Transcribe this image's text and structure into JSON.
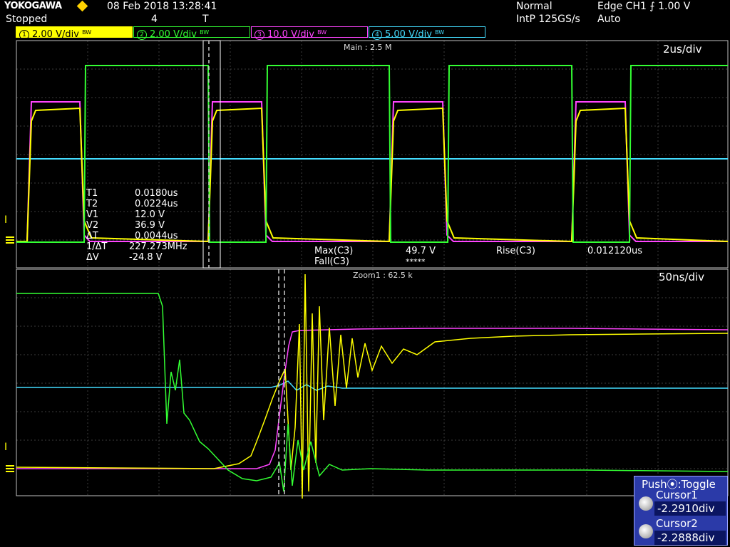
{
  "header": {
    "brand": "YOKOGAWA",
    "date_time": "08 Feb 2018 13:28:41",
    "status": "Stopped",
    "acq_count": "4",
    "mode": "Normal",
    "sampling": "IntP 125GS/s",
    "trigger": "Edge CH1 ⨍ 1.00 V",
    "trigger_mode": "Auto"
  },
  "channels": [
    {
      "num": "1",
      "scale": "2.00 V/div",
      "bw": "BW",
      "color": "#ffff00"
    },
    {
      "num": "2",
      "scale": "2.00 V/div",
      "bw": "BW",
      "color": "#33ff33"
    },
    {
      "num": "3",
      "scale": "10.0 V/div",
      "bw": "BW",
      "color": "#ff44ff"
    },
    {
      "num": "4",
      "scale": "5.00 V/div",
      "bw": "BW",
      "color": "#44ddff"
    }
  ],
  "main_panel": {
    "label": "Main : 2.5 M",
    "timebase": "2us/div"
  },
  "zoom_panel": {
    "label": "Zoom1 : 62.5 k",
    "timebase": "50ns/div"
  },
  "cursor_readout": [
    {
      "key": "T1",
      "value": "0.0180us"
    },
    {
      "key": "T2",
      "value": "0.0224us"
    },
    {
      "key": "V1",
      "value": "12.0 V"
    },
    {
      "key": "V2",
      "value": "36.9 V"
    },
    {
      "key": "ΔT",
      "value": "0.0044us"
    },
    {
      "key": "1/ΔT",
      "value": "227.273MHz"
    },
    {
      "key": "ΔV",
      "value": "-24.8 V"
    }
  ],
  "measurements": {
    "max_label": "Max(C3)",
    "max_value": "49.7 V",
    "fall_label": "Fall(C3)",
    "fall_value": "*****",
    "rise_label": "Rise(C3)",
    "rise_value": "0.012120us"
  },
  "marker_trigger": "T",
  "marker_level": "I",
  "cursor_panel": {
    "title": "Push⦿:Toggle",
    "cursor1_label": "Cursor1",
    "cursor1_value": "-2.2910div",
    "cursor2_label": "Cursor2",
    "cursor2_value": "-2.2888div"
  },
  "colors": {
    "grid": "#3d3d3d",
    "frame": "#bfbfbf",
    "yellow": "#ffff00",
    "green": "#33ff33",
    "magenta": "#ff44ff",
    "cyan": "#44ddff"
  }
}
